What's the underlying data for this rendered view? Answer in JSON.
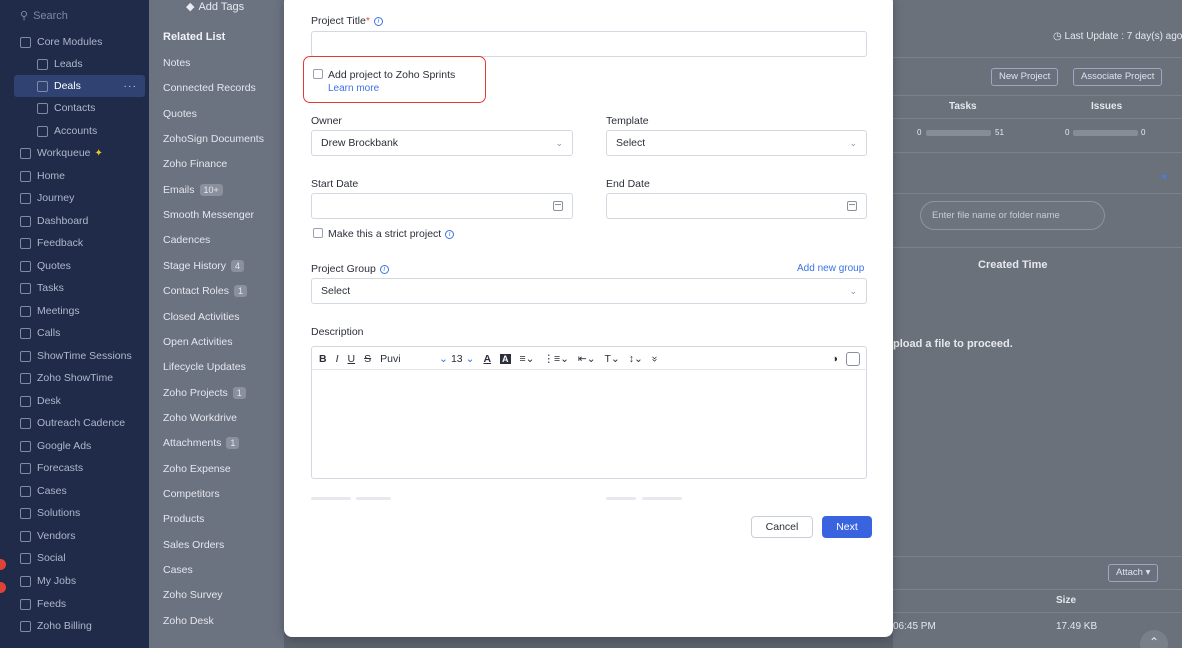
{
  "sidebar": {
    "search_placeholder": "Search",
    "items": [
      {
        "label": "Core Modules",
        "icon": "modules-icon"
      },
      {
        "label": "Leads",
        "icon": "leads-icon"
      },
      {
        "label": "Deals",
        "icon": "deals-icon",
        "more": "···"
      },
      {
        "label": "Contacts",
        "icon": "contacts-icon"
      },
      {
        "label": "Accounts",
        "icon": "accounts-icon"
      },
      {
        "label": "Workqueue",
        "icon": "workqueue-icon"
      },
      {
        "label": "Home",
        "icon": "home-icon"
      },
      {
        "label": "Journey",
        "icon": "journey-icon"
      },
      {
        "label": "Dashboard",
        "icon": "dashboard-icon"
      },
      {
        "label": "Feedback",
        "icon": "feedback-icon"
      },
      {
        "label": "Quotes",
        "icon": "quotes-icon"
      },
      {
        "label": "Tasks",
        "icon": "tasks-icon"
      },
      {
        "label": "Meetings",
        "icon": "meetings-icon"
      },
      {
        "label": "Calls",
        "icon": "calls-icon"
      },
      {
        "label": "ShowTime Sessions",
        "icon": "showtime-sessions-icon"
      },
      {
        "label": "Zoho ShowTime",
        "icon": "zoho-showtime-icon"
      },
      {
        "label": "Desk",
        "icon": "desk-icon"
      },
      {
        "label": "Outreach Cadence",
        "icon": "outreach-cadence-icon"
      },
      {
        "label": "Google Ads",
        "icon": "google-ads-icon"
      },
      {
        "label": "Forecasts",
        "icon": "forecasts-icon"
      },
      {
        "label": "Cases",
        "icon": "cases-icon"
      },
      {
        "label": "Solutions",
        "icon": "solutions-icon"
      },
      {
        "label": "Vendors",
        "icon": "vendors-icon"
      },
      {
        "label": "Social",
        "icon": "social-icon"
      },
      {
        "label": "My Jobs",
        "icon": "my-jobs-icon"
      },
      {
        "label": "Feeds",
        "icon": "feeds-icon"
      },
      {
        "label": "Zoho Billing",
        "icon": "zoho-billing-icon"
      }
    ]
  },
  "related": {
    "add_tags": "Add Tags",
    "header": "Related List",
    "items": [
      {
        "label": "Notes"
      },
      {
        "label": "Connected Records"
      },
      {
        "label": "Quotes"
      },
      {
        "label": "ZohoSign Documents"
      },
      {
        "label": "Zoho Finance"
      },
      {
        "label": "Emails",
        "count": "10+"
      },
      {
        "label": "Smooth Messenger"
      },
      {
        "label": "Cadences"
      },
      {
        "label": "Stage History",
        "count": "4"
      },
      {
        "label": "Contact Roles",
        "count": "1"
      },
      {
        "label": "Closed Activities"
      },
      {
        "label": "Open Activities"
      },
      {
        "label": "Lifecycle Updates"
      },
      {
        "label": "Zoho Projects",
        "count": "1"
      },
      {
        "label": "Zoho Workdrive"
      },
      {
        "label": "Attachments",
        "count": "1"
      },
      {
        "label": "Zoho Expense"
      },
      {
        "label": "Competitors"
      },
      {
        "label": "Products"
      },
      {
        "label": "Sales Orders"
      },
      {
        "label": "Cases"
      },
      {
        "label": "Zoho Survey"
      },
      {
        "label": "Zoho Desk"
      }
    ]
  },
  "background": {
    "last_update": "Last Update : 7 day(s) ago",
    "new_project": "New Project",
    "associate_project": "Associate Project",
    "col_tasks": "Tasks",
    "col_issues": "Issues",
    "tasks_start": "0",
    "tasks_end": "51",
    "issues_start": "0",
    "issues_end": "0",
    "file_search_placeholder": "Enter file name or folder name",
    "created_time": "Created Time",
    "upload_msg": "pload a file to proceed.",
    "attach": "Attach",
    "col_size": "Size",
    "row_time": "06:45 PM",
    "row_size": "17.49 KB"
  },
  "modal": {
    "project_title_label": "Project Title",
    "project_title_required": "*",
    "project_title_value": "",
    "sprints_checkbox_label": "Add project to Zoho Sprints",
    "learn_more": "Learn more",
    "owner_label": "Owner",
    "owner_value": "Drew Brockbank",
    "template_label": "Template",
    "template_value": "Select",
    "start_date_label": "Start Date",
    "end_date_label": "End Date",
    "strict_label": "Make this a strict project",
    "project_group_label": "Project Group",
    "add_new_group": "Add new group",
    "project_group_value": "Select",
    "description_label": "Description",
    "toolbar": {
      "bold": "B",
      "italic": "I",
      "underline": "U",
      "strike": "S",
      "font": "Puvi",
      "size": "13",
      "text_color": "A",
      "bg_color": "A",
      "more": "»"
    },
    "cancel": "Cancel",
    "next": "Next"
  }
}
